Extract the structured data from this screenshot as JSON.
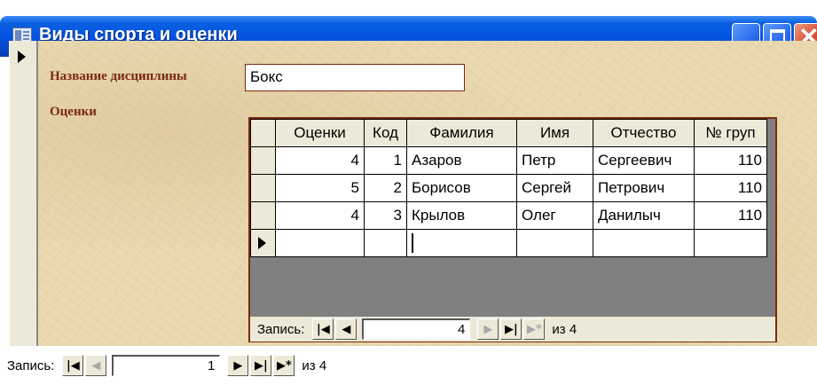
{
  "window": {
    "title": "Виды спорта и оценки",
    "icon": "form-icon"
  },
  "form": {
    "discipline_label": "Название дисциплины",
    "discipline_value": "Бокс",
    "grades_label": "Оценки"
  },
  "subform": {
    "columns": [
      "Оценки",
      "Код",
      "Фамилия",
      "Имя",
      "Отчество",
      "№ груп"
    ],
    "rows": [
      [
        "4",
        "1",
        "Азаров",
        "Петр",
        "Сергеевич",
        "110"
      ],
      [
        "5",
        "2",
        "Борисов",
        "Сергей",
        "Петрович",
        "110"
      ],
      [
        "4",
        "3",
        "Крылов",
        "Олег",
        "Данилыч",
        "110"
      ]
    ],
    "nav": {
      "label": "Запись:",
      "current": "4",
      "of_text": "из 4"
    }
  },
  "main_nav": {
    "label": "Запись:",
    "current": "1",
    "of_text": "из 4"
  },
  "colors": {
    "title_bar": "#0554e3",
    "label_color": "#7a2a0c",
    "form_background": "#ead9b0"
  }
}
